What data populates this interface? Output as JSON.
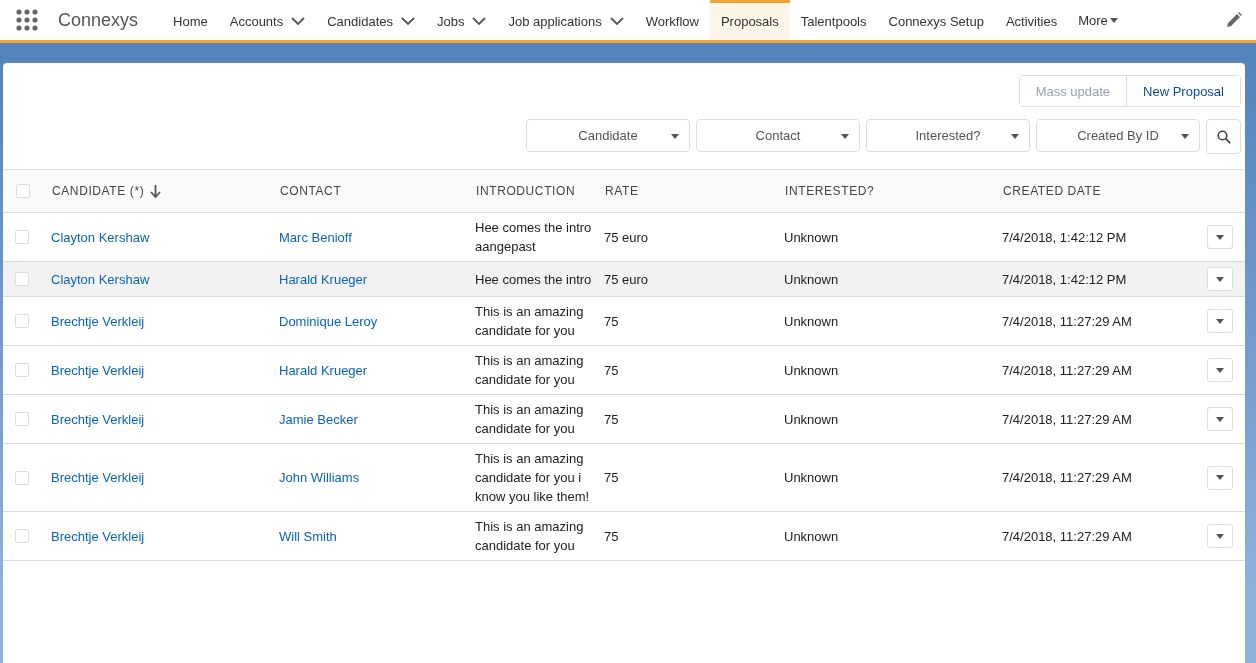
{
  "app_name": "Connexys",
  "nav": [
    {
      "label": "Home",
      "dropdown": false,
      "selected": false
    },
    {
      "label": "Accounts",
      "dropdown": true,
      "selected": false
    },
    {
      "label": "Candidates",
      "dropdown": true,
      "selected": false
    },
    {
      "label": "Jobs",
      "dropdown": true,
      "selected": false
    },
    {
      "label": "Job applications",
      "dropdown": true,
      "selected": false
    },
    {
      "label": "Workflow",
      "dropdown": false,
      "selected": false
    },
    {
      "label": "Proposals",
      "dropdown": false,
      "selected": true
    },
    {
      "label": "Talentpools",
      "dropdown": false,
      "selected": false
    },
    {
      "label": "Connexys Setup",
      "dropdown": false,
      "selected": false
    },
    {
      "label": "Activities",
      "dropdown": false,
      "selected": false
    }
  ],
  "more": "More",
  "actions": [
    {
      "label": "Mass update",
      "disabled": true
    },
    {
      "label": "New Proposal",
      "disabled": false
    }
  ],
  "filters": [
    "Candidate",
    "Contact",
    "Interested?",
    "Created By ID"
  ],
  "table": {
    "select_all_checked": false,
    "columns": [
      "CANDIDATE (*)",
      "CONTACT",
      "INTRODUCTION",
      "RATE",
      "INTERESTED?",
      "CREATED DATE"
    ],
    "rows": [
      {
        "candidate": "Clayton Kershaw",
        "contact": "Marc Benioff",
        "introduction": "Hee comes the intro aangepast",
        "rate": "75 euro",
        "interested": "Unknown",
        "created": "7/4/2018, 1:42:12 PM",
        "checked": false,
        "selected": false
      },
      {
        "candidate": "Clayton Kershaw",
        "contact": "Harald Krueger",
        "introduction": "Hee comes the intro",
        "rate": "75 euro",
        "interested": "Unknown",
        "created": "7/4/2018, 1:42:12 PM",
        "checked": false,
        "selected": true
      },
      {
        "candidate": "Brechtje Verkleij",
        "contact": "Dominique Leroy",
        "introduction": "This is an amazing candidate for you",
        "rate": "75",
        "interested": "Unknown",
        "created": "7/4/2018, 11:27:29 AM",
        "checked": false,
        "selected": false
      },
      {
        "candidate": "Brechtje Verkleij",
        "contact": "Harald Krueger",
        "introduction": "This is an amazing candidate for you",
        "rate": "75",
        "interested": "Unknown",
        "created": "7/4/2018, 11:27:29 AM",
        "checked": false,
        "selected": false
      },
      {
        "candidate": "Brechtje Verkleij",
        "contact": "Jamie Becker",
        "introduction": "This is an amazing candidate for you",
        "rate": "75",
        "interested": "Unknown",
        "created": "7/4/2018, 11:27:29 AM",
        "checked": false,
        "selected": false
      },
      {
        "candidate": "Brechtje Verkleij",
        "contact": "John Williams",
        "introduction": "This is an amazing candidate for you i know you like them!",
        "rate": "75",
        "interested": "Unknown",
        "created": "7/4/2018, 11:27:29 AM",
        "checked": false,
        "selected": false
      },
      {
        "candidate": "Brechtje Verkleij",
        "contact": "Will Smith",
        "introduction": "This is an amazing candidate for you",
        "rate": "75",
        "interested": "Unknown",
        "created": "7/4/2018, 11:27:29 AM",
        "checked": false,
        "selected": false
      }
    ]
  }
}
